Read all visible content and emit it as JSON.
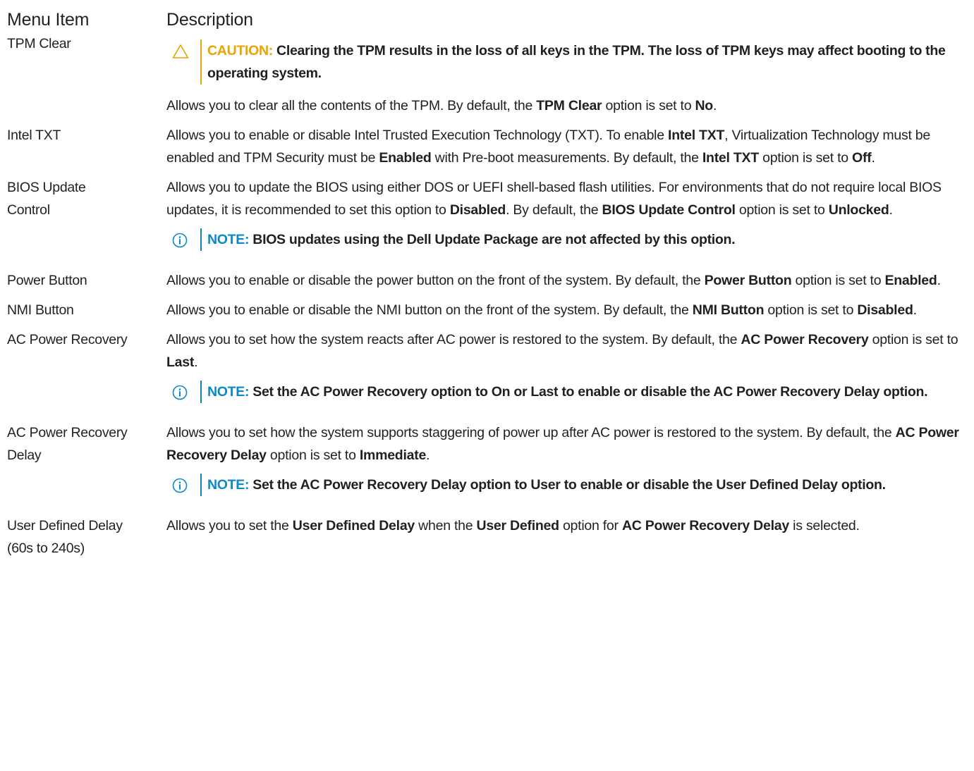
{
  "header": {
    "menu_item": "Menu Item",
    "description": "Description"
  },
  "rows": [
    {
      "item": "TPM Clear",
      "caution": {
        "label": "CAUTION:",
        "text": "Clearing the TPM results in the loss of all keys in the TPM. The loss of TPM keys may affect booting to the operating system."
      },
      "text": [
        {
          "t": "Allows you to clear all the contents of the TPM. By default, the ",
          "b": false
        },
        {
          "t": "TPM Clear",
          "b": true
        },
        {
          "t": " option is set to ",
          "b": false
        },
        {
          "t": "No",
          "b": true
        },
        {
          "t": ".",
          "b": false
        }
      ]
    },
    {
      "item": "Intel TXT",
      "text": [
        {
          "t": "Allows you to enable or disable Intel Trusted Execution Technology (TXT). To enable ",
          "b": false
        },
        {
          "t": "Intel TXT",
          "b": true
        },
        {
          "t": ", Virtualization Technology must be enabled and TPM Security must be ",
          "b": false
        },
        {
          "t": "Enabled",
          "b": true
        },
        {
          "t": " with Pre-boot measurements. By default, the ",
          "b": false
        },
        {
          "t": "Intel TXT",
          "b": true
        },
        {
          "t": " option is set to ",
          "b": false
        },
        {
          "t": "Off",
          "b": true
        },
        {
          "t": ".",
          "b": false
        }
      ]
    },
    {
      "item": "BIOS Update Control",
      "text": [
        {
          "t": "Allows you to update the BIOS using either DOS or UEFI shell-based flash utilities. For environments that do not require local BIOS updates, it is recommended to set this option to ",
          "b": false
        },
        {
          "t": "Disabled",
          "b": true
        },
        {
          "t": ". By default, the ",
          "b": false
        },
        {
          "t": "BIOS Update Control",
          "b": true
        },
        {
          "t": " option is set to ",
          "b": false
        },
        {
          "t": "Unlocked",
          "b": true
        },
        {
          "t": ".",
          "b": false
        }
      ],
      "note": {
        "label": "NOTE:",
        "text": "BIOS updates using the Dell Update Package are not affected by this option."
      }
    },
    {
      "item": "Power Button",
      "text": [
        {
          "t": "Allows you to enable or disable the power button on the front of the system. By default, the ",
          "b": false
        },
        {
          "t": "Power Button",
          "b": true
        },
        {
          "t": " option is set to ",
          "b": false
        },
        {
          "t": "Enabled",
          "b": true
        },
        {
          "t": ".",
          "b": false
        }
      ]
    },
    {
      "item": "NMI Button",
      "text": [
        {
          "t": "Allows you to enable or disable the NMI button on the front of the system. By default, the ",
          "b": false
        },
        {
          "t": "NMI Button",
          "b": true
        },
        {
          "t": " option is set to ",
          "b": false
        },
        {
          "t": "Disabled",
          "b": true
        },
        {
          "t": ".",
          "b": false
        }
      ]
    },
    {
      "item": "AC Power Recovery",
      "text": [
        {
          "t": "Allows you to set how the system reacts after AC power is restored to the system. By default, the ",
          "b": false
        },
        {
          "t": "AC Power Recovery",
          "b": true
        },
        {
          "t": " option is set to ",
          "b": false
        },
        {
          "t": "Last",
          "b": true
        },
        {
          "t": ".",
          "b": false
        }
      ],
      "note": {
        "label": "NOTE:",
        "text": "Set the AC Power Recovery option to On or Last to enable or disable the AC Power Recovery Delay option."
      }
    },
    {
      "item": "AC Power Recovery Delay",
      "text": [
        {
          "t": "Allows you to set how the system supports staggering of power up after AC power is restored to the system. By default, the ",
          "b": false
        },
        {
          "t": "AC Power Recovery Delay",
          "b": true
        },
        {
          "t": " option is set to ",
          "b": false
        },
        {
          "t": "Immediate",
          "b": true
        },
        {
          "t": ".",
          "b": false
        }
      ],
      "note": {
        "label": "NOTE:",
        "text": "Set the AC Power Recovery Delay option to User to enable or disable the User Defined Delay option."
      }
    },
    {
      "item": "User Defined Delay (60s to 240s)",
      "text": [
        {
          "t": "Allows you to set the ",
          "b": false
        },
        {
          "t": "User Defined Delay",
          "b": true
        },
        {
          "t": " when the ",
          "b": false
        },
        {
          "t": "User Defined",
          "b": true
        },
        {
          "t": " option for ",
          "b": false
        },
        {
          "t": "AC Power Recovery Delay",
          "b": true
        },
        {
          "t": " is selected.",
          "b": false
        }
      ]
    }
  ],
  "colors": {
    "text": "#231f20",
    "note_label": "#0a88c7",
    "caution_label": "#e8a400",
    "note_bar": "#1a7db5",
    "caution_bar": "#e5a50a"
  },
  "icons": {
    "note": "info-circle-icon",
    "caution": "warning-triangle-icon"
  }
}
